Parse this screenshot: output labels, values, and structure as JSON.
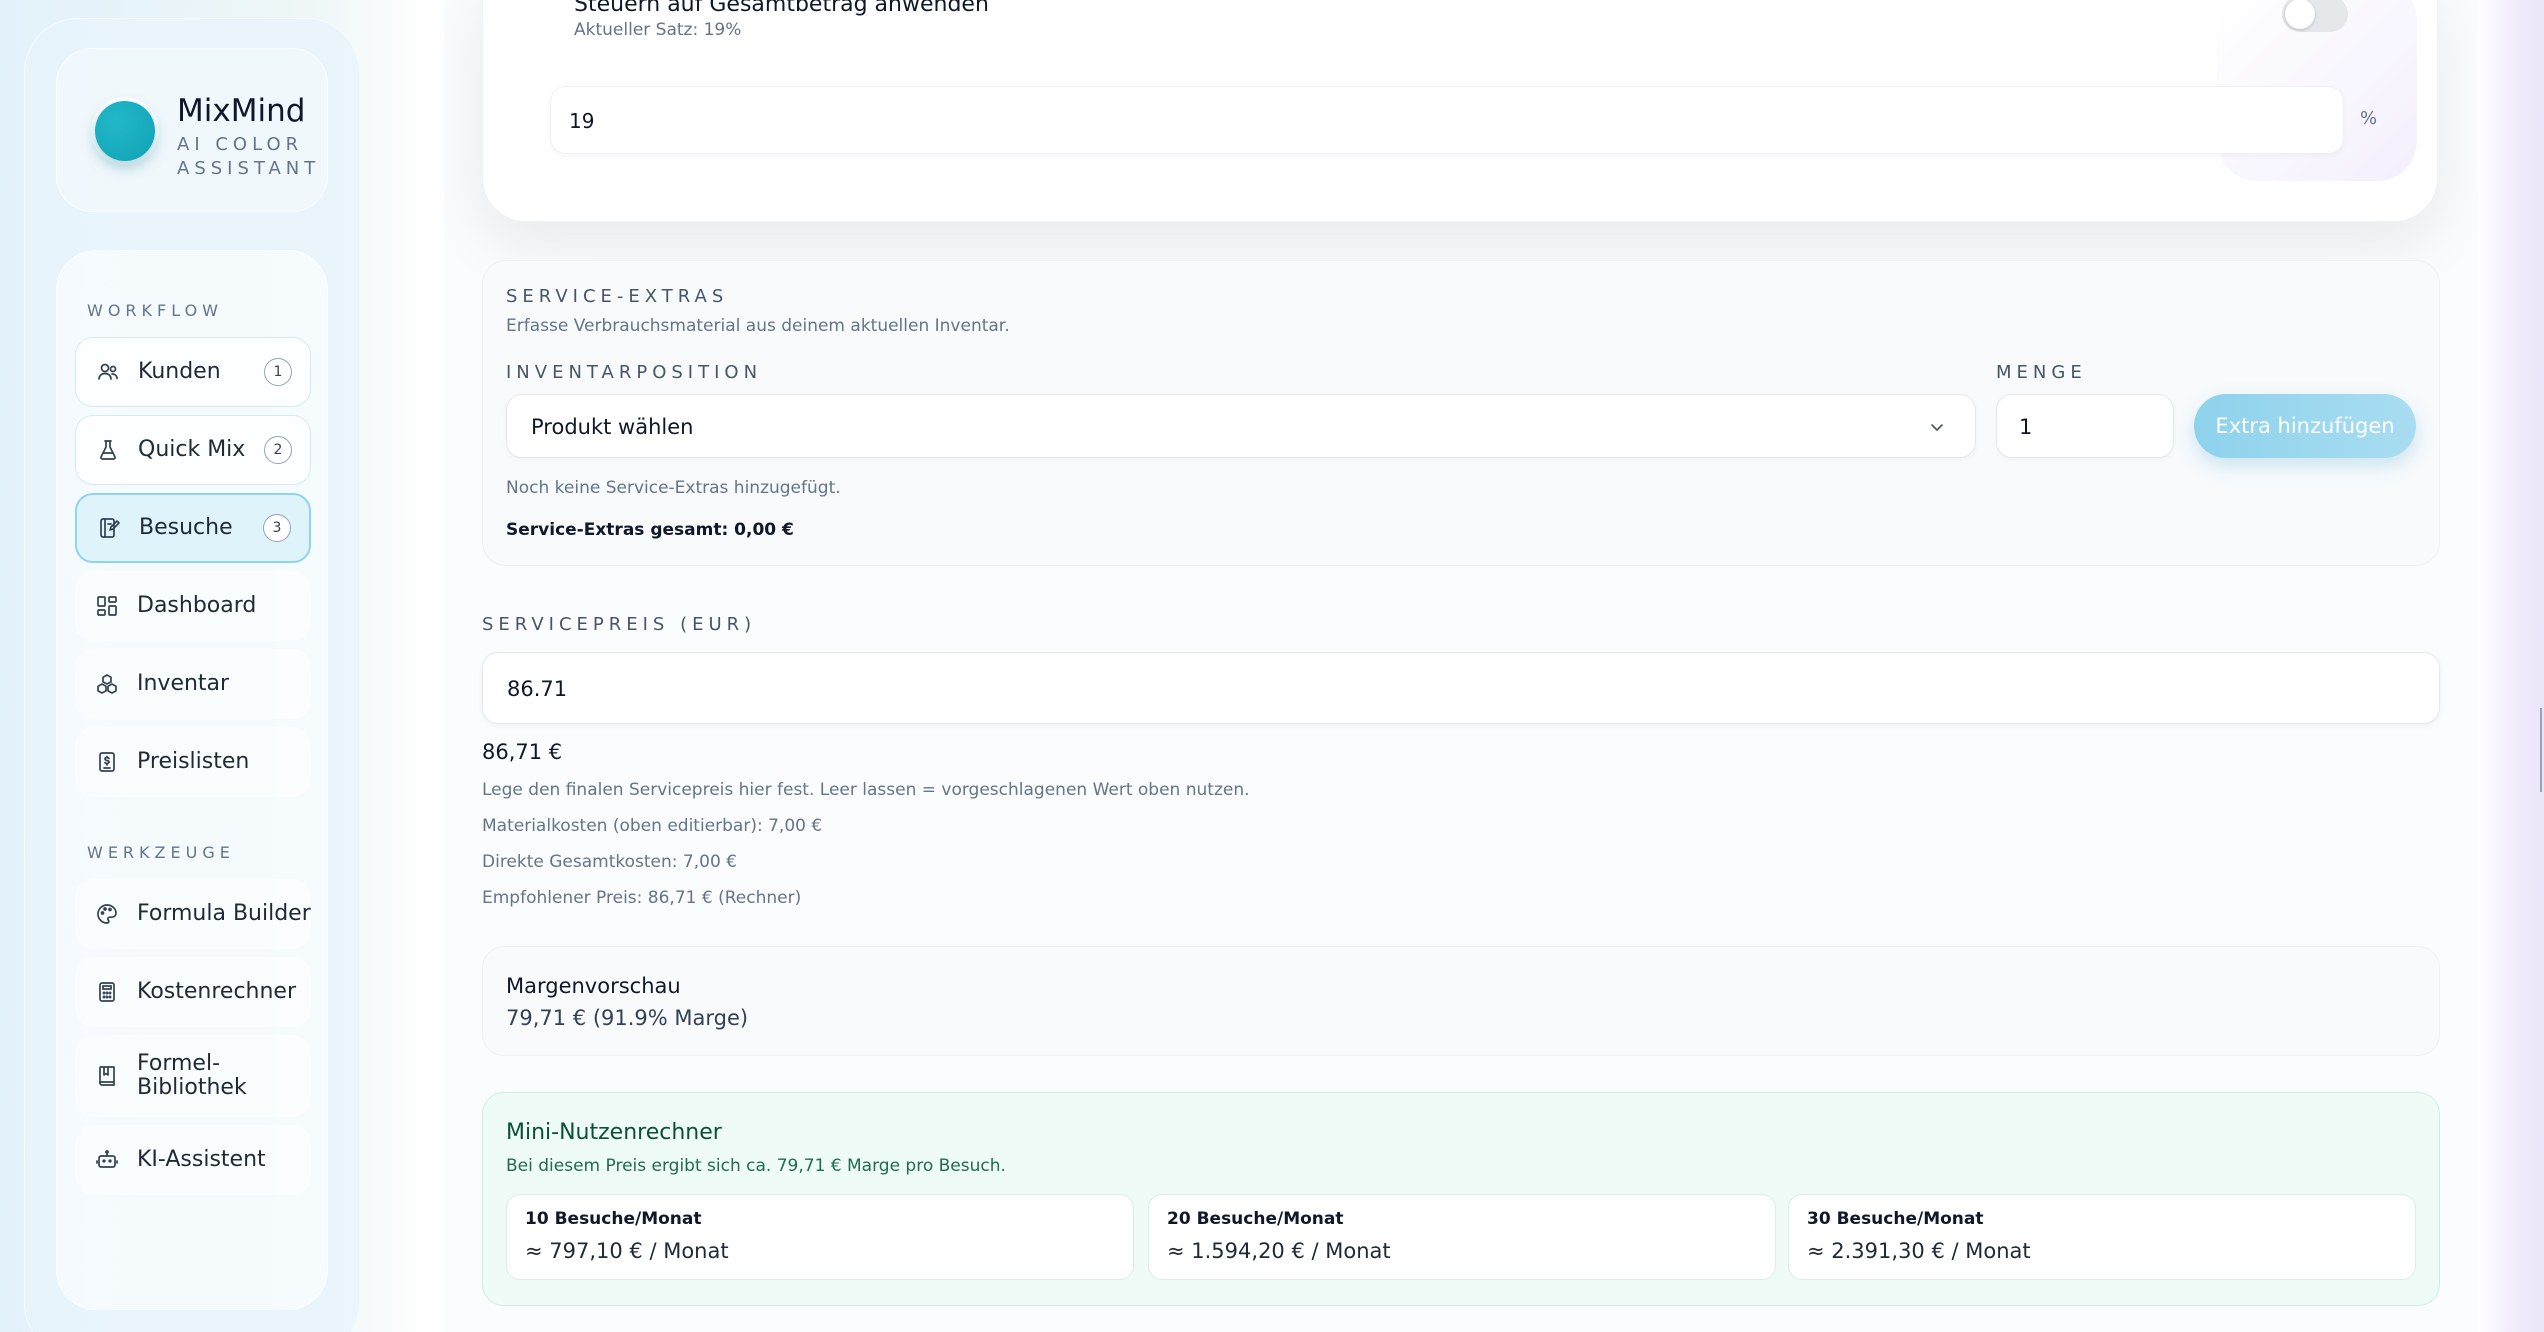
{
  "brand": {
    "name": "MixMind",
    "tagline": "AI COLOR ASSISTANT",
    "accent": "#0fa3b4"
  },
  "sidebar": {
    "workflow_heading": "WORKFLOW",
    "tools_heading": "WERKZEUGE",
    "workflow_items": [
      {
        "label": "Kunden",
        "badge": "1",
        "icon": "users-icon"
      },
      {
        "label": "Quick Mix",
        "badge": "2",
        "icon": "flask-icon"
      },
      {
        "label": "Besuche",
        "badge": "3",
        "icon": "notebook-icon",
        "active": true
      },
      {
        "label": "Dashboard",
        "icon": "dashboard-icon"
      },
      {
        "label": "Inventar",
        "icon": "boxes-icon"
      },
      {
        "label": "Preislisten",
        "icon": "price-list-icon"
      }
    ],
    "tool_items": [
      {
        "label": "Formula Builder",
        "icon": "palette-icon"
      },
      {
        "label": "Kostenrechner",
        "icon": "calculator-icon"
      },
      {
        "label": "Formel-Bibliothek",
        "icon": "book-icon"
      },
      {
        "label": "KI-Assistent",
        "icon": "bot-icon"
      }
    ]
  },
  "tax": {
    "title": "Steuern auf Gesamtbetrag anwenden",
    "subtitle": "Aktueller Satz: 19%",
    "rate_value": "19",
    "unit": "%",
    "toggle_on": false
  },
  "extras": {
    "heading": "SERVICE-EXTRAS",
    "description": "Erfasse Verbrauchsmaterial aus deinem aktuellen Inventar.",
    "inventory_label": "INVENTARPOSITION",
    "inventory_selected": "Produkt wählen",
    "quantity_label": "MENGE",
    "quantity_value": "1",
    "add_button": "Extra hinzufügen",
    "empty_text": "Noch keine Service-Extras hinzugefügt.",
    "total_text": "Service-Extras gesamt: 0,00 €"
  },
  "service_price": {
    "label": "SERVICEPREIS (EUR)",
    "value": "86.71",
    "formatted": "86,71 €",
    "hint": "Lege den finalen Servicepreis hier fest. Leer lassen = vorgeschlagenen Wert oben nutzen.",
    "material_costs": "Materialkosten (oben editierbar): 7,00 €",
    "direct_costs": "Direkte Gesamtkosten: 7,00 €",
    "recommended": "Empfohlener Preis: 86,71 € (Rechner)"
  },
  "margin": {
    "title": "Margenvorschau",
    "value": "79,71 € (91.9% Marge)"
  },
  "utility": {
    "title": "Mini-Nutzenrechner",
    "subtitle": "Bei diesem Preis ergibt sich ca. 79,71 € Marge pro Besuch.",
    "scenarios": [
      {
        "label": "10 Besuche/Monat",
        "value": "≈ 797,10 € / Monat"
      },
      {
        "label": "20 Besuche/Monat",
        "value": "≈ 1.594,20 € / Monat"
      },
      {
        "label": "30 Besuche/Monat",
        "value": "≈ 2.391,30 € / Monat"
      }
    ]
  }
}
